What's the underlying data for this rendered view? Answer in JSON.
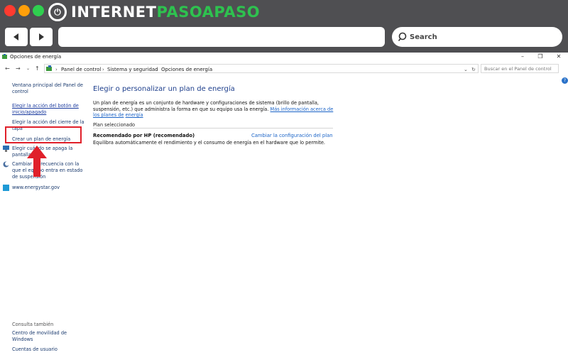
{
  "browser": {
    "logo_left": "INTERNET",
    "logo_right": "PASOAPASO",
    "search_label": "Search"
  },
  "window": {
    "title": "Opciones de energía",
    "controls": [
      "–",
      "❐",
      "✕"
    ]
  },
  "address": {
    "crumbs": [
      "Panel de control",
      "Sistema y seguridad",
      "Opciones de energía"
    ],
    "search_placeholder": "Buscar en el Panel de control"
  },
  "sidebar": {
    "items": [
      {
        "label_1": "Ventana principal del Panel de",
        "label_2": "control"
      },
      {
        "label_1": "Elegir la acción del botón de",
        "label_2": "inicio/apagado"
      },
      {
        "label_1": "Elegir la acción del cierre de la",
        "label_2": "tapa"
      },
      {
        "label_1": "Crear un plan de energía",
        "label_2": ""
      },
      {
        "label_1": "Elegir cuándo se apaga la",
        "label_2": "pantalla"
      },
      {
        "label_1": "Cambiar la frecuencia con la",
        "label_2": "que el equipo entra en estado",
        "label_3": "de suspensión"
      },
      {
        "label_1": "www.energystar.gov",
        "label_2": ""
      }
    ],
    "see_also_title": "Consulta también",
    "see_also": [
      {
        "label_1": "Centro de movilidad de",
        "label_2": "Windows"
      },
      {
        "label_1": "Cuentas de usuario",
        "label_2": ""
      }
    ]
  },
  "main": {
    "heading": "Elegir o personalizar un plan de energía",
    "desc_line1": "Un plan de energía es un conjunto de hardware y configuraciones de sistema (brillo de pantalla, suspensión,",
    "desc_line2a": "etc.) que administra la forma en que su equipo usa la energía. ",
    "desc_link1": "Más información acerca de los planes de",
    "desc_link2": "energía",
    "section_title": "Plan seleccionado",
    "plan_name": "Recomendado por HP (recomendado)",
    "change_link": "Cambiar la configuración del plan",
    "plan_desc": "Equilibra automáticamente el rendimiento y el consumo de energía en el hardware que lo permite."
  },
  "colors": {
    "highlight": "#e0202a",
    "link": "#1a63c7",
    "heading": "#1e3f8c",
    "logo_green": "#2ec24f"
  }
}
